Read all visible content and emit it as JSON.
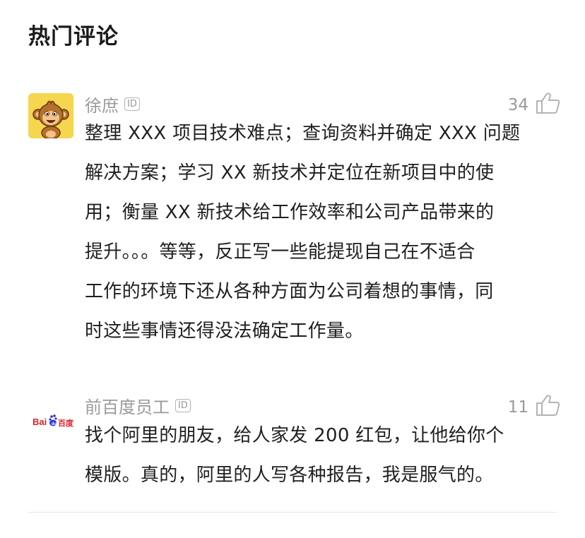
{
  "header": {
    "title": "热门评论"
  },
  "comments": [
    {
      "author": "徐庶",
      "id_badge": "ID",
      "avatar": "monkey-avatar",
      "likes": "34",
      "lines": [
        "整理 XXX 项目技术难点；查询资料并确定 XXX 问题",
        "解决方案；学习 XX 新技术并定位在新项目中的使",
        "用；衡量 XX 新技术给工作效率和公司产品带来的",
        "提升。。。等等，反正写一些能提现自己在不适合",
        "工作的环境下还从各种方面为公司着想的事情，同",
        "时这些事情还得没法确定工作量。"
      ]
    },
    {
      "author": "前百度员工",
      "id_badge": "ID",
      "avatar": "baidu-logo",
      "avatar_text": {
        "bai": "Bai",
        "du": "百度"
      },
      "likes": "11",
      "lines": [
        "找个阿里的朋友，给人家发 200 红包，让他给你个",
        "模版。真的，阿里的人写各种报告，我是服气的。"
      ]
    }
  ],
  "icons": {
    "like": "thumbs-up-icon",
    "badge": "id-badge-icon"
  },
  "colors": {
    "meta_text": "#9a9a9a",
    "body_text": "#1f1f1f",
    "avatar_bg": "#f5d64e",
    "baidu_red": "#e01f25",
    "baidu_blue": "#2932e1"
  }
}
